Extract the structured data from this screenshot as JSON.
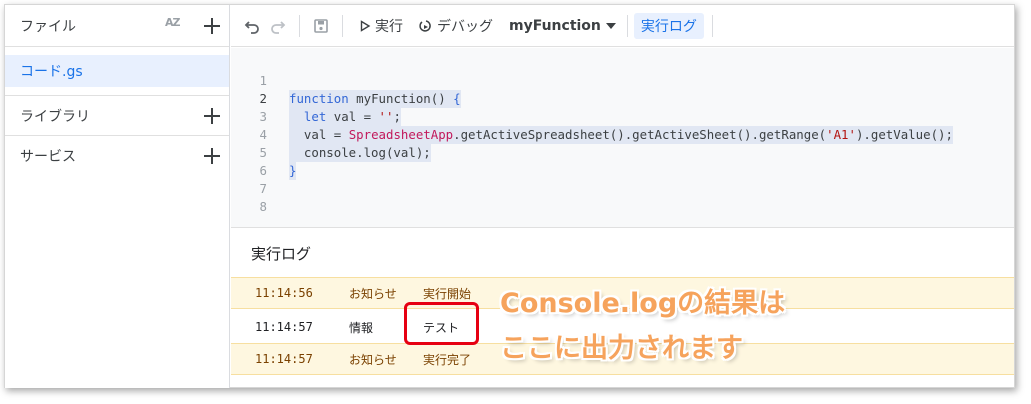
{
  "sidebar": {
    "files_label": "ファイル",
    "sort_icon_text": "AZ",
    "file_name": "コード.gs",
    "library_label": "ライブラリ",
    "services_label": "サービス"
  },
  "toolbar": {
    "run_label": "実行",
    "debug_label": "デバッグ",
    "function_name": "myFunction",
    "log_label": "実行ログ"
  },
  "editor": {
    "line_numbers": [
      "1",
      "2",
      "3",
      "4",
      "5",
      "6",
      "7",
      "8"
    ],
    "active_line": 2,
    "lines": [
      "",
      "function myFunction() {",
      "  let val = '';",
      "  val = SpreadsheetApp.getActiveSpreadsheet().getActiveSheet().getRange('A1').getValue();",
      "  console.log(val);",
      "}",
      "",
      ""
    ]
  },
  "log": {
    "title": "実行ログ",
    "rows": [
      {
        "time": "11:14:56",
        "level": "お知らせ",
        "message": "実行開始",
        "type": "notice"
      },
      {
        "time": "11:14:57",
        "level": "情報",
        "message": "テスト",
        "type": "info"
      },
      {
        "time": "11:14:57",
        "level": "お知らせ",
        "message": "実行完了",
        "type": "notice"
      }
    ]
  },
  "annotation": {
    "line1": "Console.logの結果は",
    "line2": "ここに出力されます",
    "color": "#f6a35c",
    "highlight_color": "#e60012"
  }
}
